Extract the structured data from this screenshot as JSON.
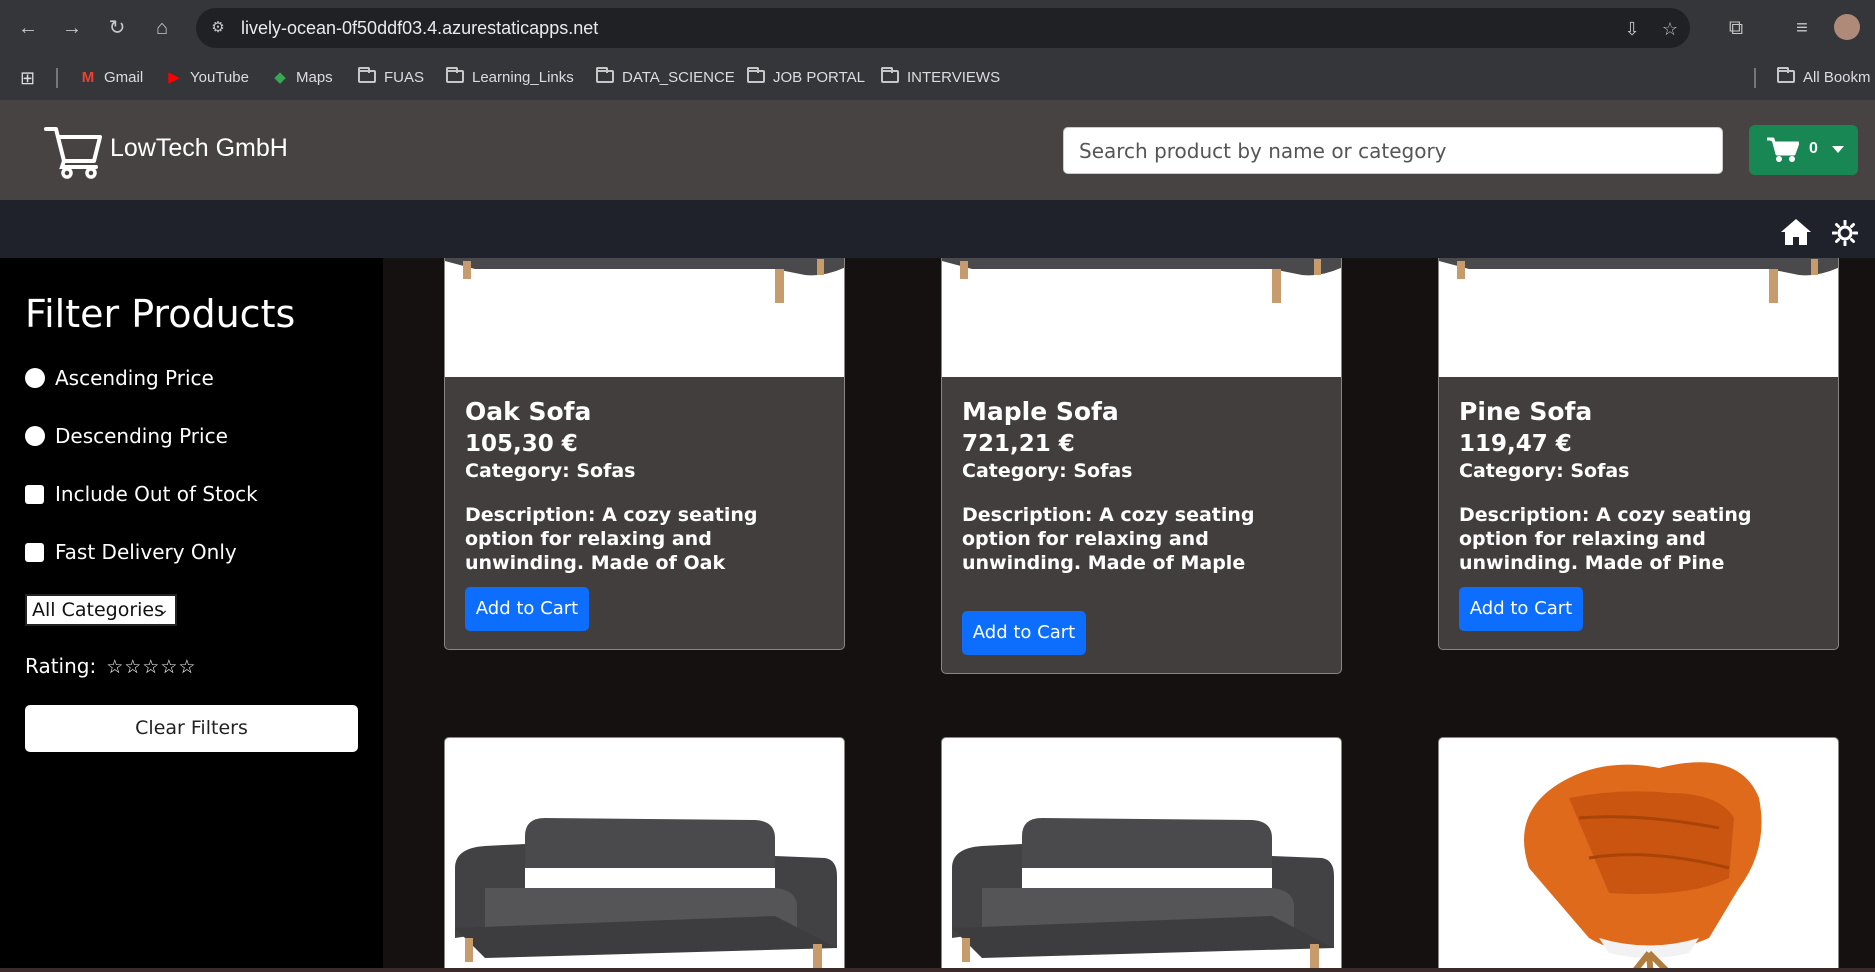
{
  "browser": {
    "url": "lively-ocean-0f50ddf03.4.azurestaticapps.net",
    "bookmarks": [
      {
        "label": "Gmail",
        "icon": "gmail-icon"
      },
      {
        "label": "YouTube",
        "icon": "youtube-icon"
      },
      {
        "label": "Maps",
        "icon": "maps-icon"
      },
      {
        "label": "FUAS",
        "icon": "folder-icon"
      },
      {
        "label": "Learning_Links",
        "icon": "folder-icon"
      },
      {
        "label": "DATA_SCIENCE",
        "icon": "folder-icon"
      },
      {
        "label": "JOB PORTAL",
        "icon": "folder-icon"
      },
      {
        "label": "INTERVIEWS",
        "icon": "folder-icon"
      }
    ],
    "all_bookmarks_label": "All Bookm"
  },
  "header": {
    "brand": "LowTech GmbH",
    "search_placeholder": "Search product by name or category",
    "cart_count": "0"
  },
  "sidebar": {
    "title": "Filter Products",
    "ascending": "Ascending Price",
    "descending": "Descending Price",
    "out_of_stock": "Include Out of Stock",
    "fast_delivery": "Fast Delivery Only",
    "category_select": "All Categories",
    "rating_label": "Rating:",
    "rating_stars": "☆☆☆☆☆",
    "clear_label": "Clear Filters"
  },
  "products": [
    {
      "name": "Oak Sofa",
      "price": "105,30 €",
      "category": "Category: Sofas",
      "description": "Description: A cozy seating option for relaxing and unwinding. Made of Oak",
      "button": "Add to Cart"
    },
    {
      "name": "Maple Sofa",
      "price": "721,21 €",
      "category": "Category: Sofas",
      "description": "Description: A cozy seating option for relaxing and unwinding. Made of Maple",
      "button": "Add to Cart"
    },
    {
      "name": "Pine Sofa",
      "price": "119,47 €",
      "category": "Category: Sofas",
      "description": "Description: A cozy seating option for relaxing and unwinding. Made of Pine",
      "button": "Add to Cart"
    }
  ],
  "colors": {
    "header": "#474343",
    "cart_button": "#198754",
    "add_button": "#0d6efd",
    "card": "#433e3e",
    "sofa_gray": "#4a4a4c",
    "chair_orange": "#e06a1b"
  }
}
